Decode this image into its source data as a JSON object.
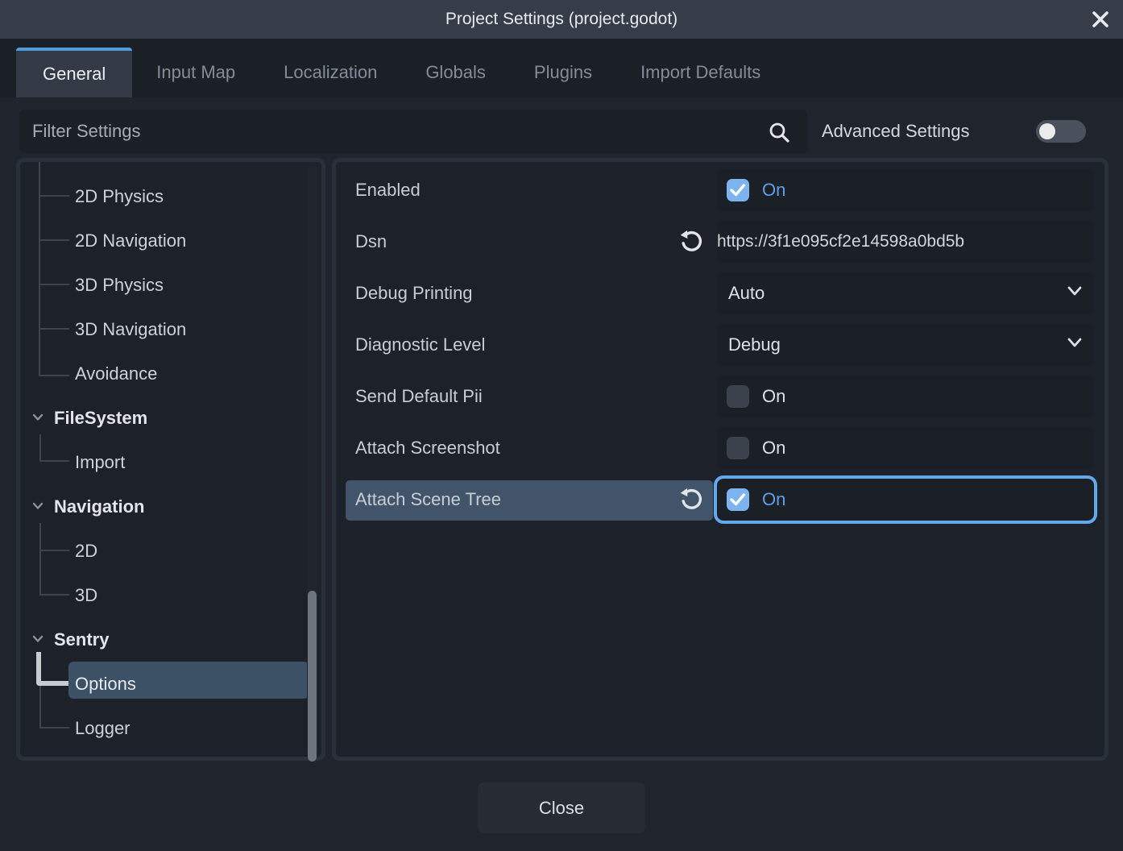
{
  "window": {
    "title": "Project Settings (project.godot)"
  },
  "tabs": [
    {
      "label": "General",
      "active": true
    },
    {
      "label": "Input Map",
      "active": false
    },
    {
      "label": "Localization",
      "active": false
    },
    {
      "label": "Globals",
      "active": false
    },
    {
      "label": "Plugins",
      "active": false
    },
    {
      "label": "Import Defaults",
      "active": false
    }
  ],
  "toolbar": {
    "filter_placeholder": "Filter Settings",
    "advanced_label": "Advanced Settings",
    "advanced_enabled": false
  },
  "sidebar": {
    "items": [
      {
        "label": "2D Physics",
        "type": "child",
        "selected": false
      },
      {
        "label": "2D Navigation",
        "type": "child",
        "selected": false
      },
      {
        "label": "3D Physics",
        "type": "child",
        "selected": false
      },
      {
        "label": "3D Navigation",
        "type": "child",
        "selected": false
      },
      {
        "label": "Avoidance",
        "type": "child",
        "selected": false
      },
      {
        "label": "FileSystem",
        "type": "header",
        "expanded": true,
        "selected": false
      },
      {
        "label": "Import",
        "type": "child",
        "selected": false
      },
      {
        "label": "Navigation",
        "type": "header",
        "expanded": true,
        "selected": false
      },
      {
        "label": "2D",
        "type": "child",
        "selected": false
      },
      {
        "label": "3D",
        "type": "child",
        "selected": false
      },
      {
        "label": "Sentry",
        "type": "header",
        "expanded": true,
        "selected": false
      },
      {
        "label": "Options",
        "type": "child",
        "selected": true
      },
      {
        "label": "Logger",
        "type": "child",
        "selected": false
      }
    ]
  },
  "properties": {
    "rows": [
      {
        "label": "Enabled",
        "type": "checkbox",
        "checked": true,
        "value_label": "On",
        "revert": false,
        "highlighted": false
      },
      {
        "label": "Dsn",
        "type": "text",
        "value": "https://3f1e095cf2e14598a0bd5b",
        "revert": true,
        "highlighted": false
      },
      {
        "label": "Debug Printing",
        "type": "dropdown",
        "value": "Auto",
        "revert": false,
        "highlighted": false
      },
      {
        "label": "Diagnostic Level",
        "type": "dropdown",
        "value": "Debug",
        "revert": false,
        "highlighted": false
      },
      {
        "label": "Send Default Pii",
        "type": "checkbox",
        "checked": false,
        "value_label": "On",
        "revert": false,
        "highlighted": false
      },
      {
        "label": "Attach Screenshot",
        "type": "checkbox",
        "checked": false,
        "value_label": "On",
        "revert": false,
        "highlighted": false
      },
      {
        "label": "Attach Scene Tree",
        "type": "checkbox",
        "checked": true,
        "value_label": "On",
        "revert": true,
        "highlighted": true,
        "focused": true
      }
    ]
  },
  "footer": {
    "close_label": "Close"
  },
  "colors": {
    "accent_tab": "#4f9edb",
    "checkbox_checked": "#7db4f0",
    "on_text_blue": "#5d9fe9",
    "row_highlight": "#415469",
    "tree_selected": "#3d5166",
    "focus_border": "#64a8ec",
    "titlebar": "#373d48",
    "panel_bg": "#1d222a",
    "panel_border": "#2a303b",
    "field_bg": "#1b2026"
  }
}
